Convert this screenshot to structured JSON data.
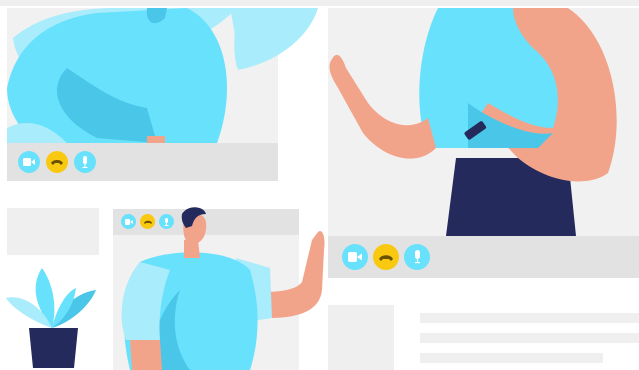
{
  "colors": {
    "shirt": "#68e1fd",
    "shirt_shadow": "#4ac6e8",
    "shirt_light": "#a9ecfb",
    "skin": "#f2a48a",
    "pants": "#242a5c",
    "hair": "#242a5c",
    "hangup": "#f9c912",
    "panel": "#f1f1f1",
    "bar": "#e2e2e2"
  },
  "icons": {
    "camera": "video-camera-icon",
    "hangup": "phone-hangup-icon",
    "mic": "microphone-icon"
  }
}
